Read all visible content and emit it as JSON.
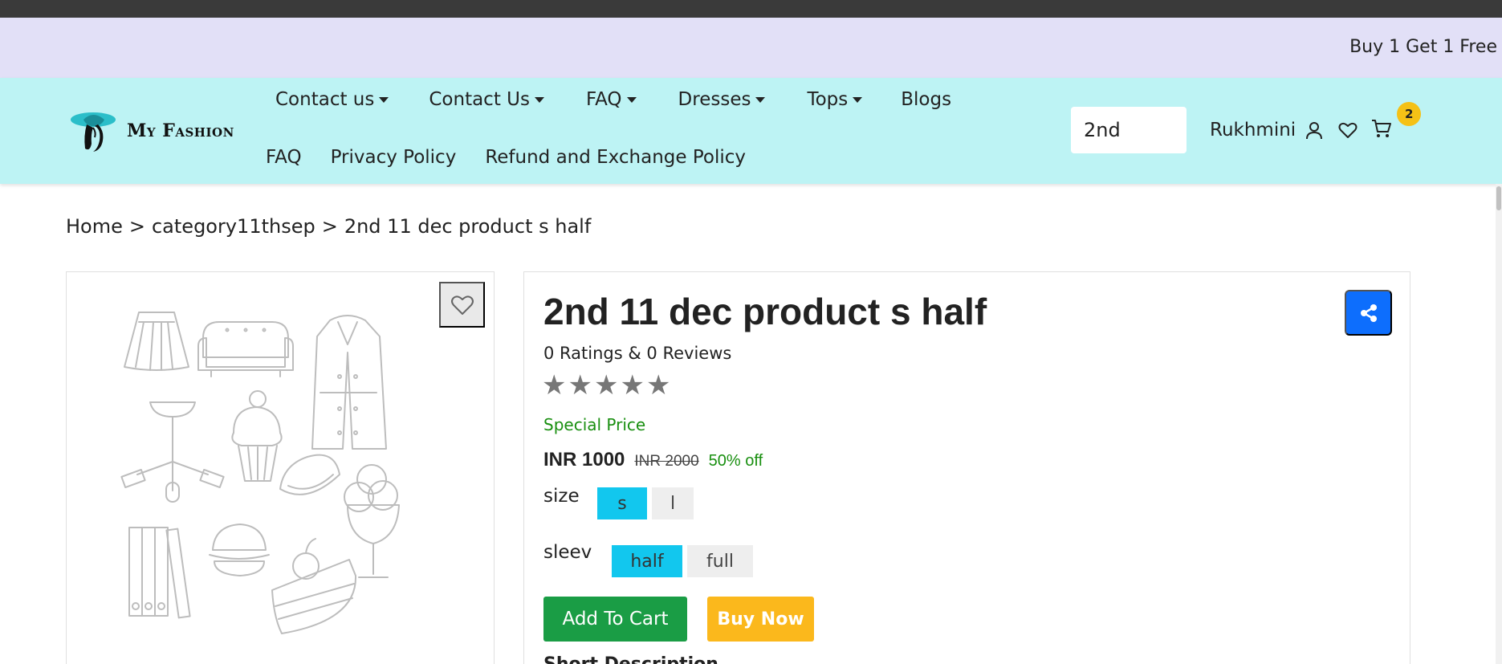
{
  "promo": {
    "text": "Buy 1 Get 1 Free"
  },
  "brand": {
    "name": "My Fashion"
  },
  "nav": {
    "row1": [
      {
        "label": "Contact us",
        "dropdown": true
      },
      {
        "label": "Contact Us",
        "dropdown": true
      },
      {
        "label": "FAQ",
        "dropdown": true
      },
      {
        "label": "Dresses",
        "dropdown": true
      },
      {
        "label": "Tops",
        "dropdown": true
      },
      {
        "label": "Blogs",
        "dropdown": false
      }
    ],
    "row2": [
      {
        "label": "FAQ"
      },
      {
        "label": "Privacy Policy"
      },
      {
        "label": "Refund and Exchange Policy"
      }
    ]
  },
  "search": {
    "value": "2nd"
  },
  "user": {
    "name": "Rukhmini",
    "cart_count": "2"
  },
  "breadcrumb": {
    "items": [
      "Home",
      "category11thsep",
      "2nd 11 dec product s half"
    ],
    "separator": ">"
  },
  "product": {
    "title": "2nd 11 dec product s half",
    "ratings_text": "0 Ratings & 0 Reviews",
    "rating": 0,
    "rating_max": 5,
    "special_price_label": "Special Price",
    "price": "INR 1000",
    "mrp": "INR 2000",
    "discount": "50% off",
    "size": {
      "label": "size",
      "options": [
        "s",
        "l"
      ],
      "selected": "s"
    },
    "sleeve": {
      "label": "sleev",
      "options": [
        "half",
        "full"
      ],
      "selected": "half"
    },
    "add_to_cart_label": "Add To Cart",
    "buy_now_label": "Buy Now",
    "short_description_label": "Short Description"
  },
  "icons": {
    "user": "user-icon",
    "wishlist": "heart-icon",
    "cart": "cart-icon",
    "share": "share-icon"
  },
  "colors": {
    "promo_bg": "#e2e0f7",
    "nav_bg": "#bdf3f4",
    "accent_blue": "#0d6efd",
    "option_selected": "#12c7ee",
    "add_to_cart": "#1a9d45",
    "buy_now": "#fbb81c",
    "price_green": "#198f10",
    "badge_yellow": "#f5c116"
  }
}
